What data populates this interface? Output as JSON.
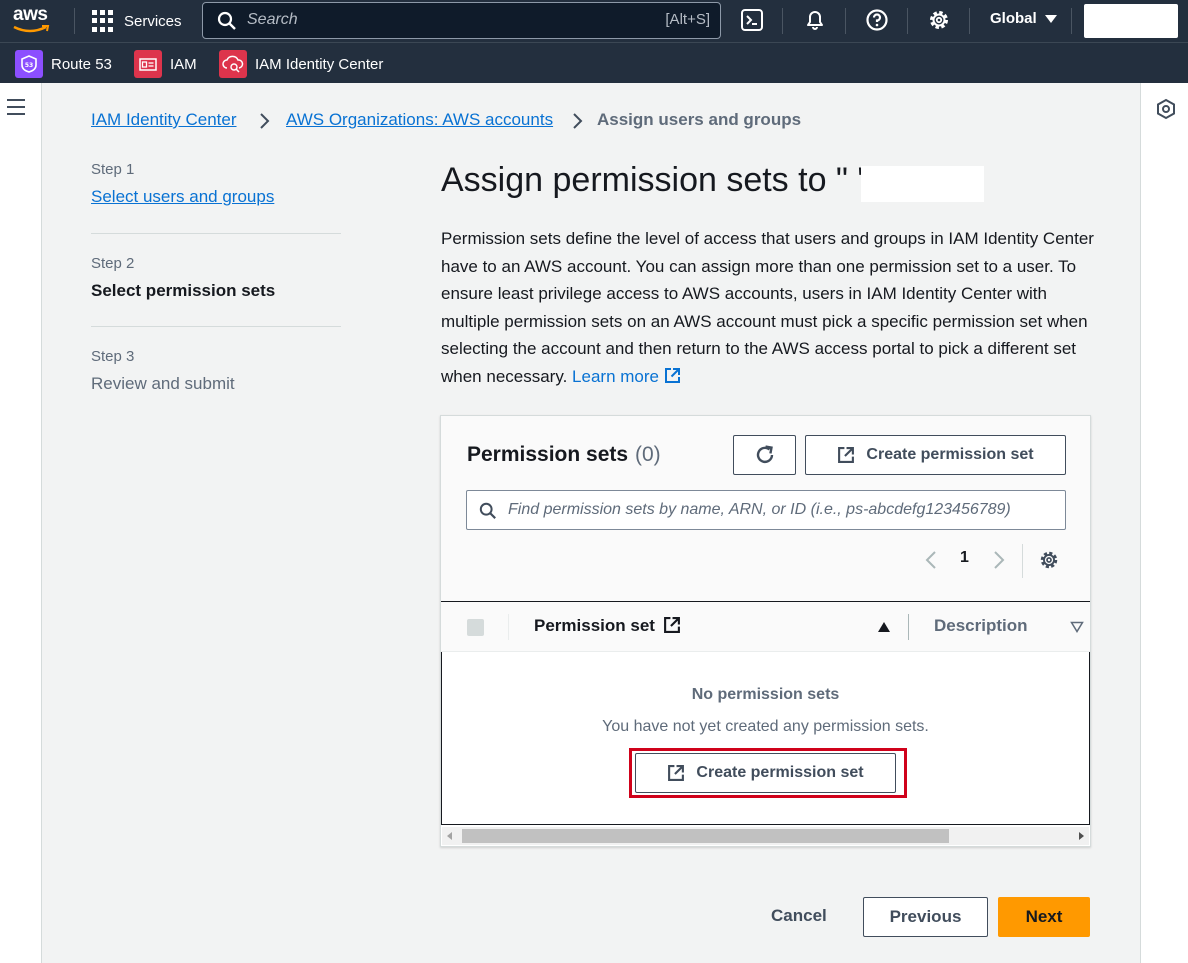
{
  "topnav": {
    "logo_text": "aws",
    "services_label": "Services",
    "search_placeholder": "Search",
    "search_shortcut": "[Alt+S]",
    "region_label": "Global",
    "icons": [
      "cloudshell-icon",
      "bell-icon",
      "help-icon",
      "gear-icon"
    ]
  },
  "service_bar": {
    "items": [
      {
        "label": "Route 53",
        "color": "#8c4fff"
      },
      {
        "label": "IAM",
        "color": "#dd344c"
      },
      {
        "label": "IAM Identity Center",
        "color": "#dd344c"
      }
    ]
  },
  "breadcrumb": {
    "items": [
      "IAM Identity Center",
      "AWS Organizations: AWS accounts"
    ],
    "current": "Assign users and groups"
  },
  "steps": [
    {
      "number": "Step 1",
      "title": "Select users and groups",
      "state": "link"
    },
    {
      "number": "Step 2",
      "title": "Select permission sets",
      "state": "active"
    },
    {
      "number": "Step 3",
      "title": "Review and submit",
      "state": "disabled"
    }
  ],
  "main": {
    "heading": "Assign permission sets to \"          \"",
    "description": "Permission sets define the level of access that users and groups in IAM Identity Center have to an AWS account. You can assign more than one permission set to a user. To ensure least privilege access to AWS accounts, users in IAM Identity Center with multiple permission sets on an AWS account must pick a specific permission set when selecting the account and then return to the AWS access portal to pick a different set when necessary.",
    "learn_more": "Learn more"
  },
  "panel": {
    "title": "Permission sets",
    "count": "(0)",
    "create_label": "Create permission set",
    "filter_placeholder": "Find permission sets by name, ARN, or ID (i.e., ps-abcdefg123456789)",
    "page": "1",
    "columns": [
      "Permission set",
      "Description"
    ],
    "empty_title": "No permission sets",
    "empty_subtitle": "You have not yet created any permission sets.",
    "empty_create_label": "Create permission set"
  },
  "footer": {
    "cancel": "Cancel",
    "previous": "Previous",
    "next": "Next"
  },
  "colors": {
    "nav_bg": "#232f3e",
    "link": "#0972d3",
    "primary": "#ff9900",
    "highlight": "#d0021b"
  }
}
